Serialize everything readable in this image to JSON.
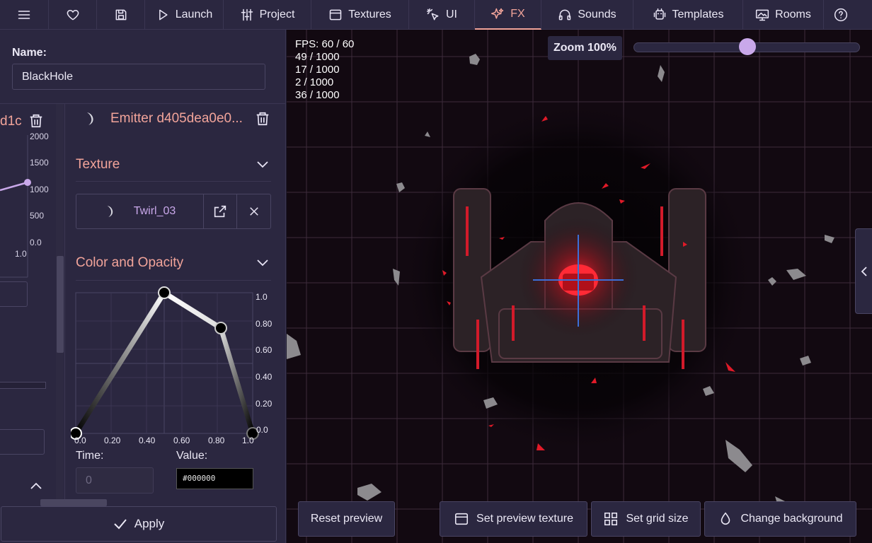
{
  "nav": {
    "launch": "Launch",
    "project": "Project",
    "textures": "Textures",
    "ui": "UI",
    "fx": "FX",
    "sounds": "Sounds",
    "templates": "Templates",
    "rooms": "Rooms"
  },
  "editor": {
    "name_label": "Name:",
    "name_value": "BlackHole",
    "left_emitter_title_fragment": "d1c",
    "left_graph_ticks": [
      "2000",
      "1500",
      "1000",
      "500",
      "0.0"
    ],
    "left_graph_x_tick": "1.0",
    "emitter_title": "Emitter d405dea0e0...",
    "texture_section": "Texture",
    "texture_name": "Twirl_03",
    "color_section": "Color and Opacity",
    "curve_y_ticks": [
      "1.0",
      "0.80",
      "0.60",
      "0.40",
      "0.20",
      "0.0"
    ],
    "curve_x_ticks": [
      "0.0",
      "0.20",
      "0.40",
      "0.60",
      "0.80",
      "1.0"
    ],
    "curve_points": [
      {
        "time": 0.0,
        "value": 0.0
      },
      {
        "time": 0.52,
        "value": 1.0
      },
      {
        "time": 0.83,
        "value": 0.79
      },
      {
        "time": 1.0,
        "value": 0.0
      }
    ],
    "time_label": "Time:",
    "time_placeholder": "0",
    "value_label": "Value:",
    "value_text": "#000000",
    "apply": "Apply"
  },
  "preview": {
    "stats": [
      "FPS: 60 / 60",
      "49 / 1000",
      "17 / 1000",
      "2 / 1000",
      "36 / 1000"
    ],
    "zoom_label": "Zoom 100%",
    "zoom_level": 0.5,
    "buttons": {
      "reset": "Reset preview",
      "set_texture": "Set preview texture",
      "grid_size": "Set grid size",
      "background": "Change background"
    }
  },
  "colors": {
    "accent": "#f2a49a",
    "lavender": "#c9a8ea",
    "panel": "#2b2740",
    "canvas": "#120911"
  }
}
